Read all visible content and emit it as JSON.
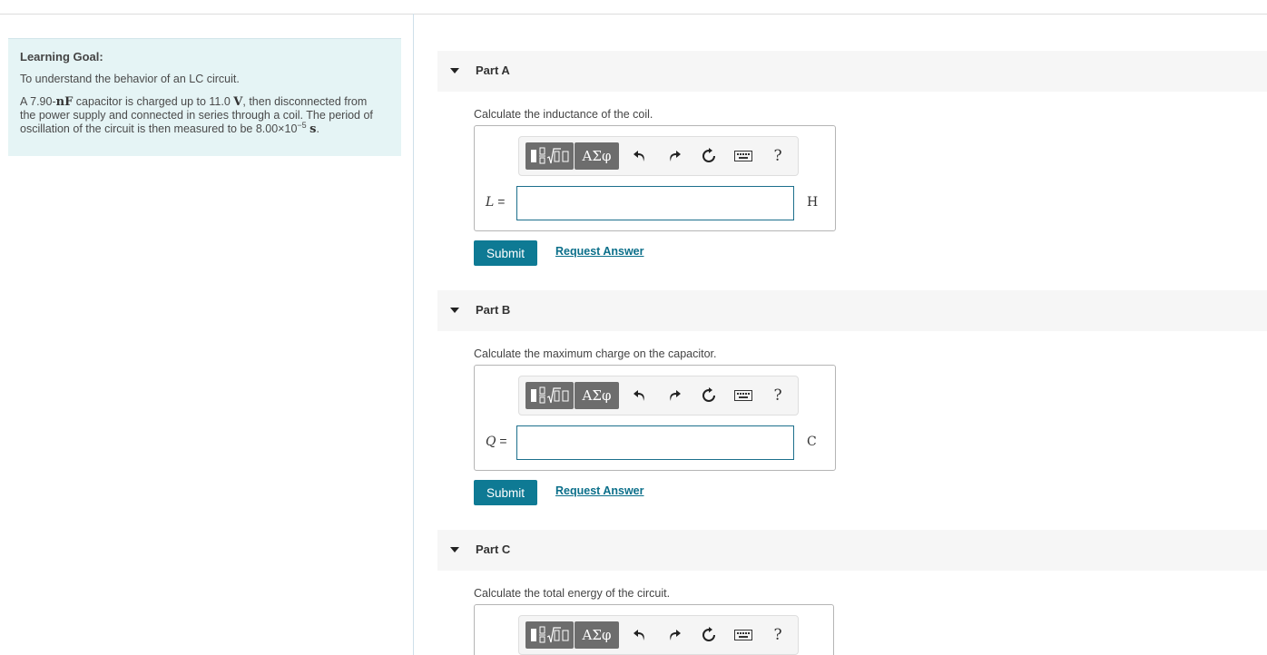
{
  "goal": {
    "title": "Learning Goal:",
    "intro": "To understand the behavior of an LC circuit.",
    "line1_a": "A 7.90-",
    "line1_unit1": "nF",
    "line1_b": " capacitor is charged up to 11.0 ",
    "line1_unit2": "V",
    "line1_c": ", then disconnected from",
    "line2": "the power supply and connected in series through a coil. The period of",
    "line3_a": "oscillation of the circuit is then measured to be 8.00×10",
    "line3_exp": "−5",
    "line3_unit": "s",
    "line3_end": "."
  },
  "toolbar": {
    "greek_label": "ΑΣφ",
    "help_label": "?",
    "icons": [
      "templates-icon",
      "undo-icon",
      "redo-icon",
      "reset-icon",
      "keyboard-icon",
      "help-icon"
    ]
  },
  "parts": [
    {
      "title": "Part A",
      "question": "Calculate the inductance of the coil.",
      "variable": "L",
      "equals": "=",
      "value": "",
      "unit": "H",
      "submit_label": "Submit",
      "request_label": "Request Answer"
    },
    {
      "title": "Part B",
      "question": "Calculate the maximum charge on the capacitor.",
      "variable": "Q",
      "equals": "=",
      "value": "",
      "unit": "C",
      "submit_label": "Submit",
      "request_label": "Request Answer"
    },
    {
      "title": "Part C",
      "question": "Calculate the total energy of the circuit."
    }
  ],
  "colors": {
    "accent": "#0e7a94",
    "goal_background": "#e5f4f5",
    "toolbar_button": "#6d6d6d",
    "input_border": "#1c6f8c"
  }
}
